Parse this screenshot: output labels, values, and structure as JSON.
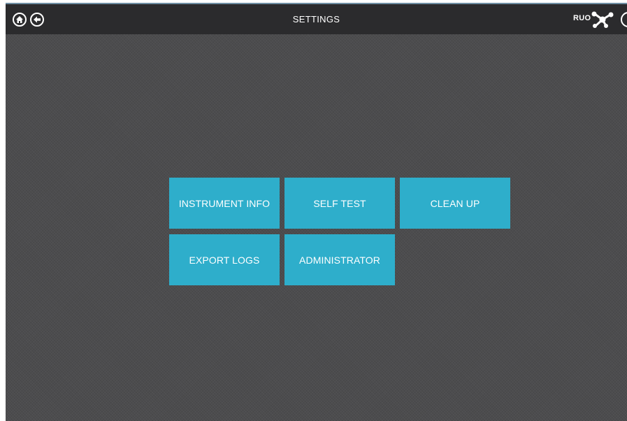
{
  "header": {
    "title": "SETTINGS",
    "mode_badge": "RUO",
    "icons": {
      "home": "home-icon",
      "back": "arrow-left-icon",
      "network": "network-hub-icon"
    }
  },
  "tiles": [
    {
      "label": "INSTRUMENT INFO"
    },
    {
      "label": "SELF TEST"
    },
    {
      "label": "CLEAN UP"
    },
    {
      "label": "EXPORT LOGS"
    },
    {
      "label": "ADMINISTRATOR"
    }
  ],
  "colors": {
    "background": "#4c4c4e",
    "header": "#2b2b2d",
    "tile": "#2eaecb",
    "text": "#ffffff"
  }
}
